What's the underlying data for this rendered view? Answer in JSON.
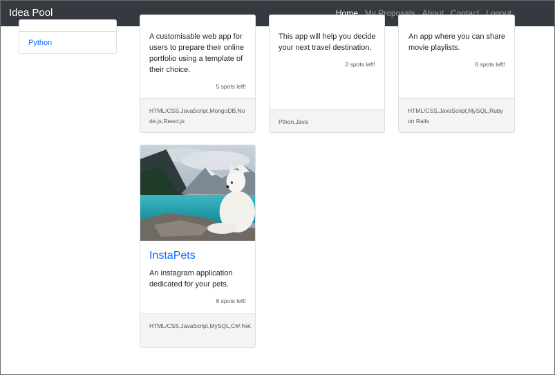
{
  "navbar": {
    "brand": "Idea Pool",
    "links": [
      "Home",
      "My Proposals",
      "About",
      "Contact",
      "Logout"
    ]
  },
  "sidebar": {
    "items": [
      "Python"
    ]
  },
  "cards": [
    {
      "description": "A customisable web app for users to prepare their online portfolio using a template of their choice.",
      "spots": "5 spots left!",
      "tags": "HTML/CSS,JavaScript,MongoDB,Node.js,React.js"
    },
    {
      "description": "This app will help you decide your next travel destination.",
      "spots": "2 spots left!",
      "tags": "Pthon,Java"
    },
    {
      "description": "An app where you can share movie playlists.",
      "spots": "6 spots left!",
      "tags": "HTML/CSS,JavaScript,MySQL,Ruby on Rails"
    },
    {
      "title": "InstaPets",
      "description": "An instagram application dedicated for your pets.",
      "spots": "8 spots left!",
      "tags": "HTML/CSS,JavaScript,MySQL,C#/.Net"
    }
  ],
  "colors": {
    "navbar": "#343a40",
    "link": "#0d6efd",
    "footer": "#f4f4f4"
  }
}
